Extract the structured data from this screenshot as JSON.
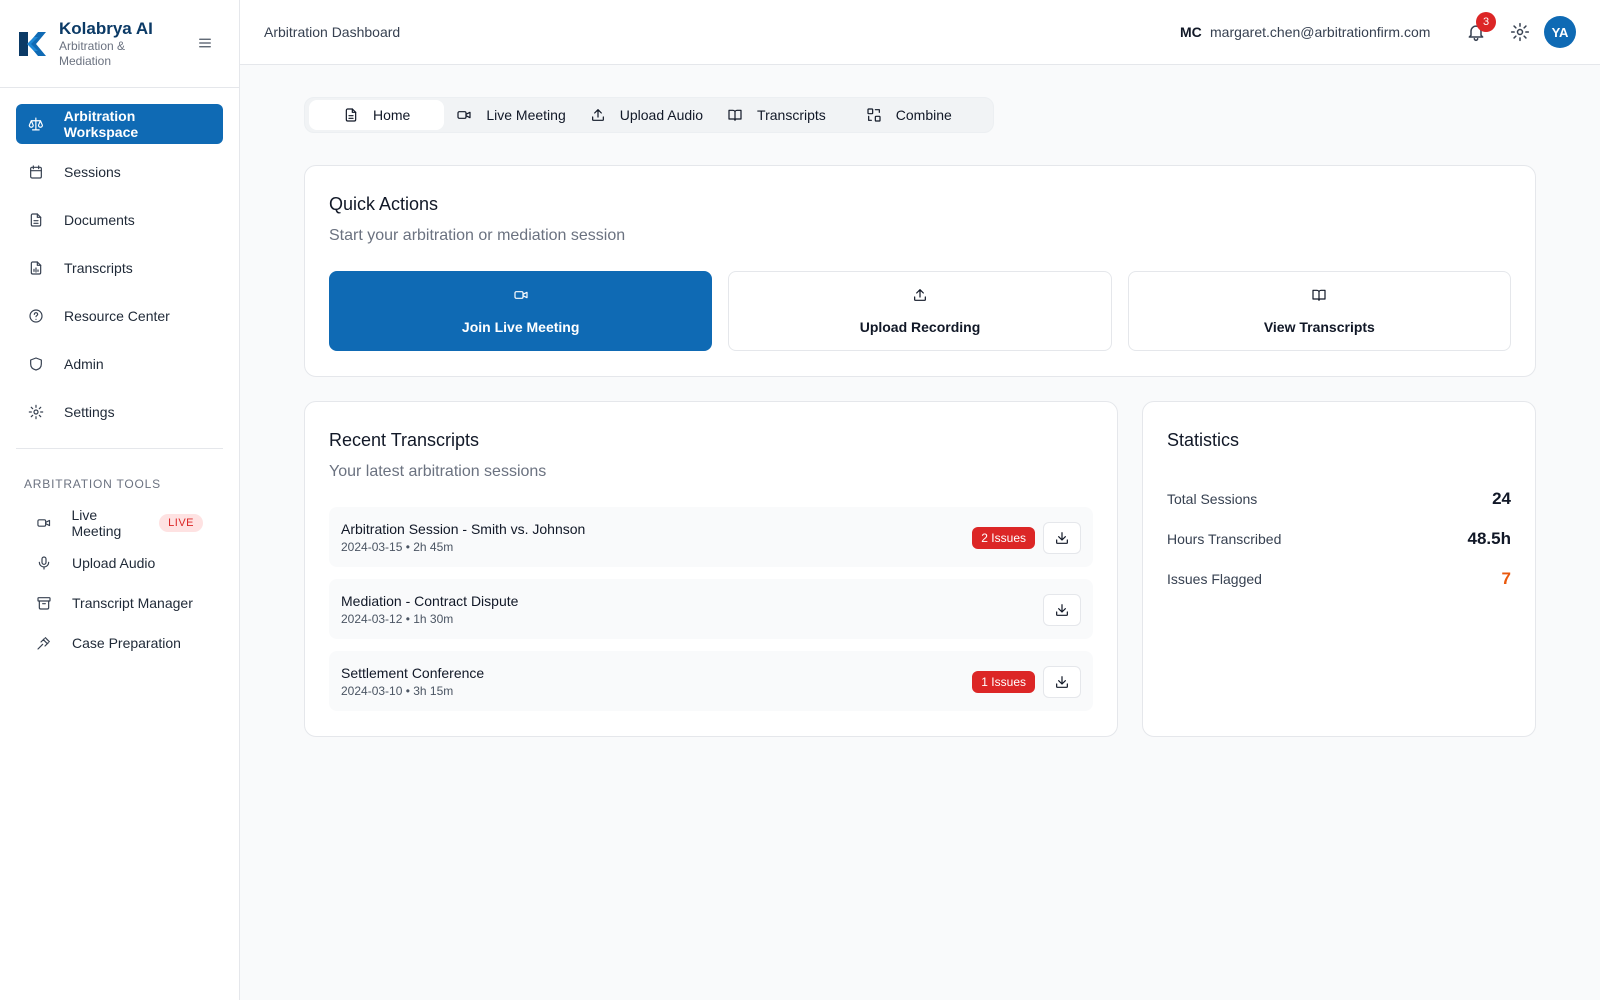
{
  "brand": {
    "name": "Kolabrya AI",
    "subtitle": "Arbitration & Mediation"
  },
  "sidebar": {
    "items": [
      {
        "label": "Arbitration Workspace",
        "icon": "scale-icon",
        "active": true
      },
      {
        "label": "Sessions",
        "icon": "calendar-icon"
      },
      {
        "label": "Documents",
        "icon": "file-text-icon"
      },
      {
        "label": "Transcripts",
        "icon": "file-audio-icon"
      },
      {
        "label": "Resource Center",
        "icon": "help-circle-icon"
      },
      {
        "label": "Admin",
        "icon": "shield-icon"
      },
      {
        "label": "Settings",
        "icon": "gear-icon"
      }
    ],
    "tools_title": "ARBITRATION TOOLS",
    "tools": [
      {
        "label": "Live Meeting",
        "icon": "video-icon",
        "badge": "LIVE"
      },
      {
        "label": "Upload Audio",
        "icon": "mic-icon"
      },
      {
        "label": "Transcript Manager",
        "icon": "archive-icon"
      },
      {
        "label": "Case Preparation",
        "icon": "gavel-icon"
      }
    ]
  },
  "header": {
    "title": "Arbitration Dashboard",
    "user_initials": "MC",
    "user_email": "margaret.chen@arbitrationfirm.com",
    "notification_count": "3",
    "avatar": "YA"
  },
  "tabs": [
    {
      "label": "Home",
      "icon": "file-icon",
      "active": true
    },
    {
      "label": "Live Meeting",
      "icon": "video-icon"
    },
    {
      "label": "Upload Audio",
      "icon": "upload-icon"
    },
    {
      "label": "Transcripts",
      "icon": "book-open-icon"
    },
    {
      "label": "Combine",
      "icon": "combine-icon"
    }
  ],
  "quick_actions": {
    "title": "Quick Actions",
    "subtitle": "Start your arbitration or mediation session",
    "buttons": [
      {
        "label": "Join Live Meeting",
        "icon": "video-icon",
        "primary": true
      },
      {
        "label": "Upload Recording",
        "icon": "upload-icon"
      },
      {
        "label": "View Transcripts",
        "icon": "book-open-icon"
      }
    ]
  },
  "recent": {
    "title": "Recent Transcripts",
    "subtitle": "Your latest arbitration sessions",
    "rows": [
      {
        "title": "Arbitration Session - Smith vs. Johnson",
        "meta": "2024-03-15 • 2h 45m",
        "issues": "2 Issues"
      },
      {
        "title": "Mediation - Contract Dispute",
        "meta": "2024-03-12 • 1h 30m",
        "issues": ""
      },
      {
        "title": "Settlement Conference",
        "meta": "2024-03-10 • 3h 15m",
        "issues": "1 Issues"
      }
    ]
  },
  "stats": {
    "title": "Statistics",
    "items": [
      {
        "label": "Total Sessions",
        "value": "24"
      },
      {
        "label": "Hours Transcribed",
        "value": "48.5h"
      },
      {
        "label": "Issues Flagged",
        "value": "7",
        "color": "#ea580c"
      }
    ]
  },
  "colors": {
    "primary": "#0f6ab4",
    "danger": "#dc2626",
    "warning": "#ea580c"
  }
}
